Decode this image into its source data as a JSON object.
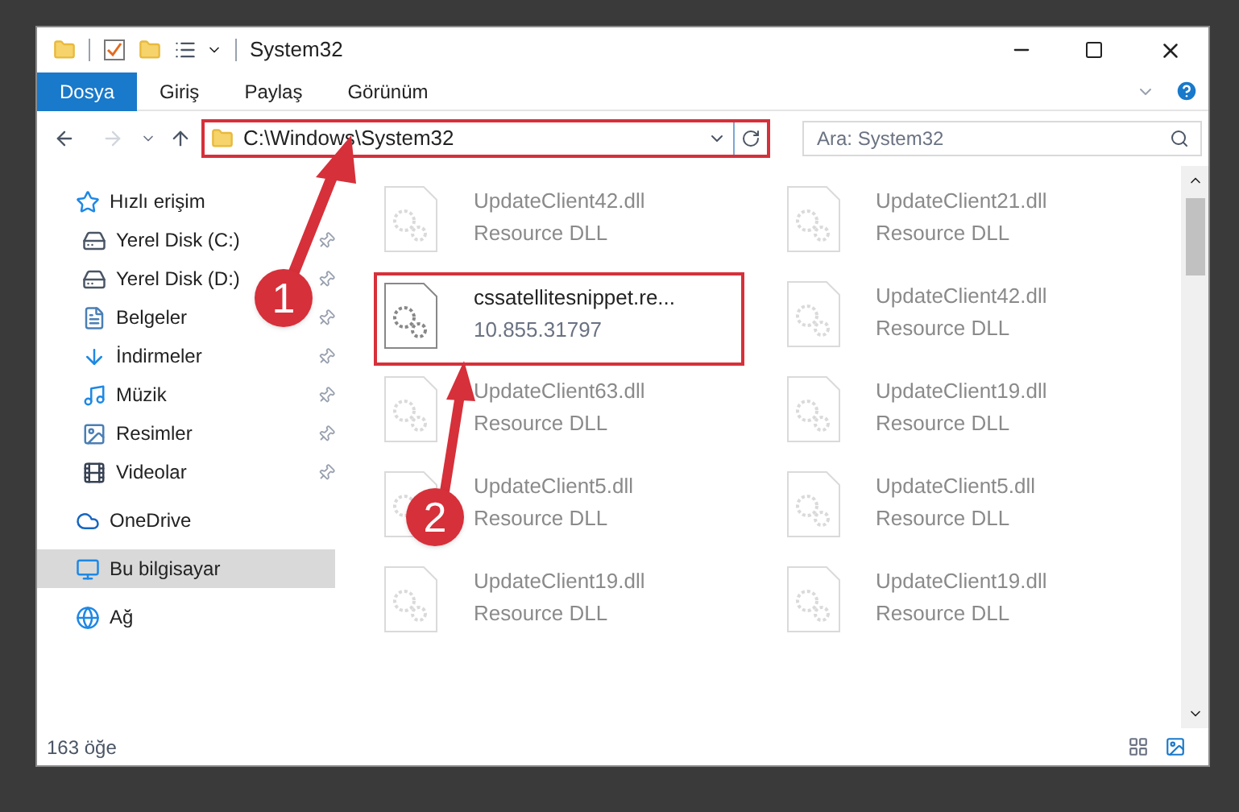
{
  "window": {
    "title": "System32"
  },
  "ribbon_tabs": [
    {
      "label": "Dosya",
      "selected": true
    },
    {
      "label": "Giriş",
      "selected": false
    },
    {
      "label": "Paylaş",
      "selected": false
    },
    {
      "label": "Görünüm",
      "selected": false
    }
  ],
  "address_bar": {
    "path": "C:\\Windows\\System32",
    "highlighted": true
  },
  "search": {
    "placeholder": "Ara: System32"
  },
  "sidebar": {
    "items": [
      {
        "label": "Hızlı erişim",
        "selected": false,
        "children": [
          {
            "label": "Yerel Disk (C:)",
            "selected": false,
            "pinned": true
          },
          {
            "label": "Yerel Disk (D:)",
            "selected": false,
            "pinned": true
          },
          {
            "label": "Belgeler",
            "selected": false,
            "pinned": true
          },
          {
            "label": "İndirmeler",
            "selected": false,
            "pinned": true
          },
          {
            "label": "Müzik",
            "selected": false,
            "pinned": true
          },
          {
            "label": "Resimler",
            "selected": false,
            "pinned": true
          },
          {
            "label": "Videolar",
            "selected": false,
            "pinned": true
          }
        ]
      },
      {
        "label": "OneDrive",
        "selected": false
      },
      {
        "label": "Bu bilgisayar",
        "selected": true
      },
      {
        "label": "Ağ",
        "selected": false
      }
    ]
  },
  "files": [
    {
      "name": "UpdateClient42.dll",
      "detail": "Resource DLL",
      "blurred": true,
      "highlighted": false
    },
    {
      "name": "UpdateClient21.dll",
      "detail": "Resource DLL",
      "blurred": true,
      "highlighted": false
    },
    {
      "name": "cssatellitesnippet.re...",
      "detail": "10.855.31797",
      "blurred": false,
      "highlighted": true
    },
    {
      "name": "UpdateClient42.dll",
      "detail": "Resource DLL",
      "blurred": true,
      "highlighted": false
    },
    {
      "name": "UpdateClient63.dll",
      "detail": "Resource DLL",
      "blurred": true,
      "highlighted": false
    },
    {
      "name": "UpdateClient19.dll",
      "detail": "Resource DLL",
      "blurred": true,
      "highlighted": false
    },
    {
      "name": "UpdateClient5.dll",
      "detail": "Resource DLL",
      "blurred": true,
      "highlighted": false
    },
    {
      "name": "UpdateClient5.dll",
      "detail": "Resource DLL",
      "blurred": true,
      "highlighted": false
    },
    {
      "name": "UpdateClient19.dll",
      "detail": "Resource DLL",
      "blurred": true,
      "highlighted": false
    },
    {
      "name": "UpdateClient19.dll",
      "detail": "Resource DLL",
      "blurred": true,
      "highlighted": false
    }
  ],
  "status_bar": {
    "item_count": "163 öğe"
  },
  "callouts": [
    {
      "number": "1"
    },
    {
      "number": "2"
    }
  ]
}
